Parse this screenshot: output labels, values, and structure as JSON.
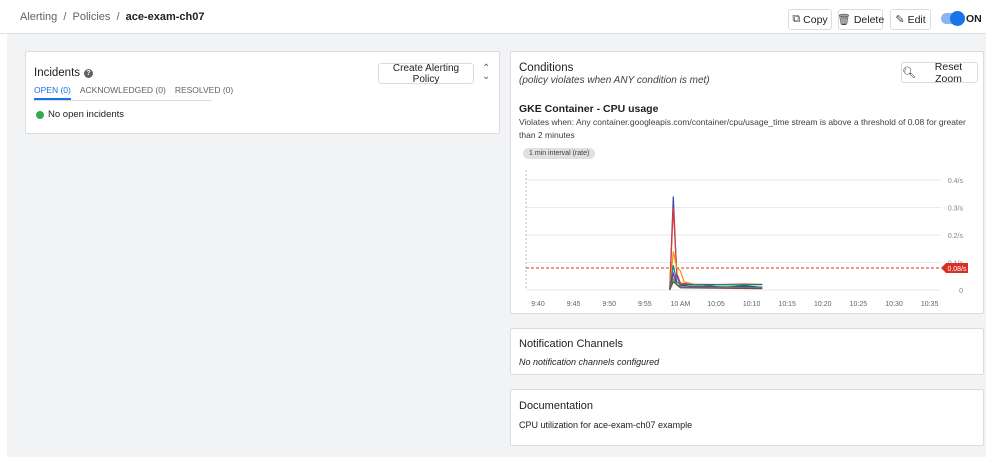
{
  "breadcrumb": {
    "items": [
      "Alerting",
      "Policies"
    ],
    "separator": "/",
    "current": "ace-exam-ch07"
  },
  "toolbar": {
    "copy_label": "Copy",
    "delete_label": "Delete",
    "edit_label": "Edit",
    "toggle_label": "ON",
    "toggle_on": true
  },
  "incidents": {
    "title": "Incidents",
    "create_button": "Create Alerting Policy",
    "tabs": [
      {
        "label": "OPEN (0)",
        "active": true
      },
      {
        "label": "ACKNOWLEDGED (0)",
        "active": false
      },
      {
        "label": "RESOLVED (0)",
        "active": false
      }
    ],
    "empty_message": "No open incidents"
  },
  "conditions": {
    "title": "Conditions",
    "subtitle": "(policy violates when ANY condition is met)",
    "reset_zoom_label": "Reset Zoom",
    "condition_name": "GKE Container - CPU usage",
    "condition_description": "Violates when: Any container.googleapis.com/container/cpu/usage_time stream is above a threshold of 0.08 for greater than 2 minutes",
    "interval_chip": "1 min interval (rate)"
  },
  "chart_data": {
    "type": "line",
    "x_tick_labels": [
      "9:40",
      "9:45",
      "9:50",
      "9:55",
      "10 AM",
      "10:05",
      "10:10",
      "10:15",
      "10:20",
      "10:25",
      "10:30",
      "10:35"
    ],
    "y_tick_labels": [
      "0.4/s",
      "0.3/s",
      "0.2/s",
      "0.1/s",
      "0"
    ],
    "y_ticks": [
      0.4,
      0.3,
      0.2,
      0.1,
      0
    ],
    "ylim": [
      0,
      0.4
    ],
    "threshold": {
      "value": 0.08,
      "label": "0.08/s",
      "color": "#d93025"
    },
    "series": [
      {
        "color": "#3949ab",
        "points": [
          [
            18.5,
            0
          ],
          [
            19,
            0.34
          ],
          [
            19.5,
            0.05
          ],
          [
            20,
            0.02
          ],
          [
            22,
            0.01
          ],
          [
            24,
            0.015
          ],
          [
            26,
            0.01
          ],
          [
            29,
            0.015
          ],
          [
            31.5,
            0.01
          ]
        ]
      },
      {
        "color": "#e53935",
        "points": [
          [
            18.5,
            0
          ],
          [
            19,
            0.3
          ],
          [
            19.5,
            0.06
          ],
          [
            20,
            0.025
          ],
          [
            22,
            0.02
          ],
          [
            24,
            0.018
          ],
          [
            26,
            0.02
          ],
          [
            29,
            0.022
          ],
          [
            31.5,
            0.02
          ]
        ]
      },
      {
        "color": "#fb8c00",
        "points": [
          [
            18.5,
            0
          ],
          [
            19,
            0.14
          ],
          [
            19.5,
            0.08
          ],
          [
            20,
            0.07
          ],
          [
            20.5,
            0.03
          ],
          [
            22,
            0.02
          ],
          [
            26,
            0.02
          ],
          [
            31.5,
            0.02
          ]
        ]
      },
      {
        "color": "#00897b",
        "points": [
          [
            18.5,
            0
          ],
          [
            19,
            0.09
          ],
          [
            19.5,
            0.03
          ],
          [
            20,
            0.02
          ],
          [
            24,
            0.02
          ],
          [
            28,
            0.018
          ],
          [
            31.5,
            0.02
          ]
        ]
      },
      {
        "color": "#8e24aa",
        "points": [
          [
            18.5,
            0
          ],
          [
            19,
            0.06
          ],
          [
            19.5,
            0.02
          ],
          [
            20,
            0.015
          ],
          [
            25,
            0.012
          ],
          [
            31.5,
            0.01
          ]
        ]
      },
      {
        "color": "#43a047",
        "points": [
          [
            18.5,
            0
          ],
          [
            19,
            0.04
          ],
          [
            19.5,
            0.02
          ],
          [
            20,
            0.01
          ],
          [
            26,
            0.01
          ],
          [
            31.5,
            0.008
          ]
        ]
      },
      {
        "color": "#6d4c41",
        "points": [
          [
            18.5,
            0
          ],
          [
            19,
            0.03
          ],
          [
            20,
            0.008
          ],
          [
            31.5,
            0.005
          ]
        ]
      }
    ]
  },
  "notification_channels": {
    "title": "Notification Channels",
    "message": "No notification channels configured"
  },
  "documentation": {
    "title": "Documentation",
    "content": "CPU utilization for ace-exam-ch07 example"
  }
}
